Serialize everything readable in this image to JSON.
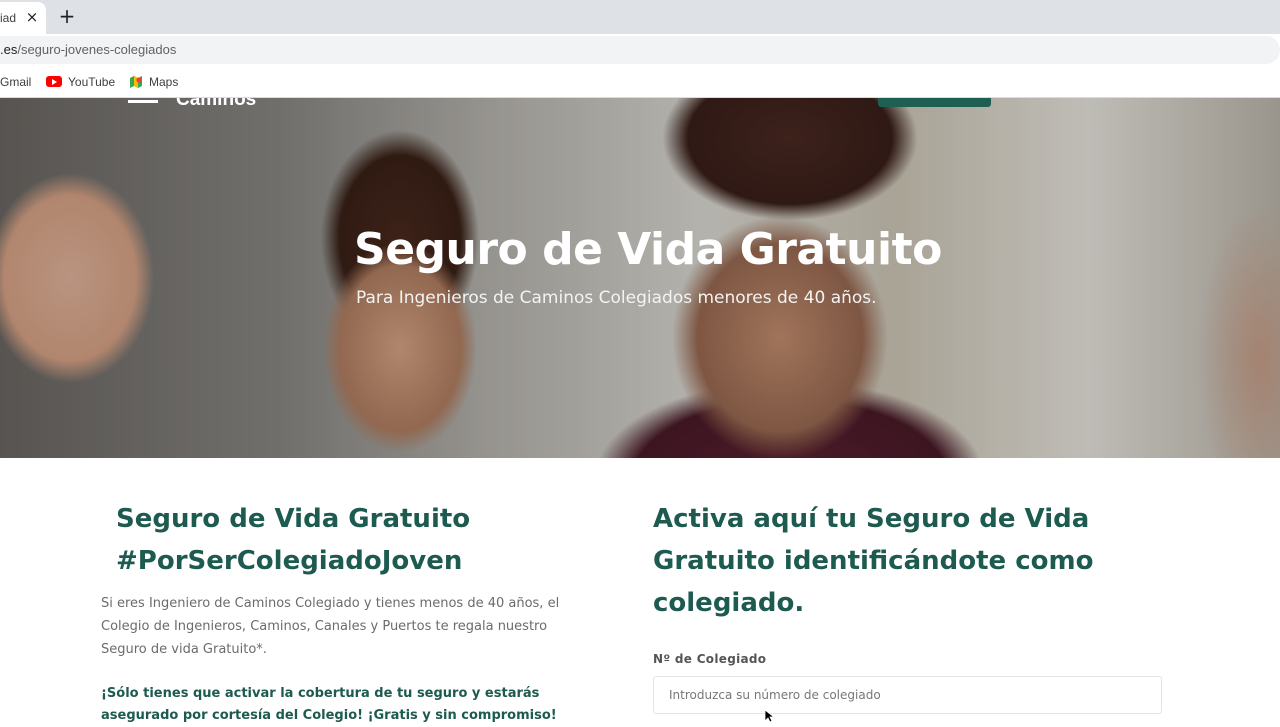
{
  "browser": {
    "tab_title": "iad",
    "close_tab_glyph": "×",
    "new_tab_glyph": "+",
    "url_domain": ".es",
    "url_path": "/seguro-jovenes-colegiados",
    "bookmarks": [
      {
        "label": "Gmail",
        "icon": "gmail-icon"
      },
      {
        "label": "YouTube",
        "icon": "youtube-icon"
      },
      {
        "label": "Maps",
        "icon": "maps-icon"
      }
    ]
  },
  "hero": {
    "brand": "Caminos",
    "title": "Seguro de Vida Gratuito",
    "subtitle": "Para Ingenieros de Caminos Colegiados menores de 40 años."
  },
  "left": {
    "title_line1": "Seguro de Vida Gratuito",
    "title_line2": "#PorSerColegiadoJoven",
    "paragraph": "Si eres Ingeniero de Caminos Colegiado y tienes menos de 40 años, el Colegio de Ingenieros, Caminos, Canales y Puertos te regala nuestro Seguro de vida Gratuito*.",
    "highlight": "¡Sólo tienes que activar la cobertura de tu seguro y estarás asegurado por cortesía del Colegio! ¡Gratis y sin compromiso!"
  },
  "form": {
    "title": "Activa aquí tu Seguro de Vida Gratuito identificándote como colegiado.",
    "colegiado_label": "Nº de Colegiado",
    "colegiado_placeholder": "Introduzca su número de colegiado",
    "colegiado_value": ""
  },
  "colors": {
    "brand_green": "#1d5a4f",
    "cta_green": "#1f5f52"
  }
}
